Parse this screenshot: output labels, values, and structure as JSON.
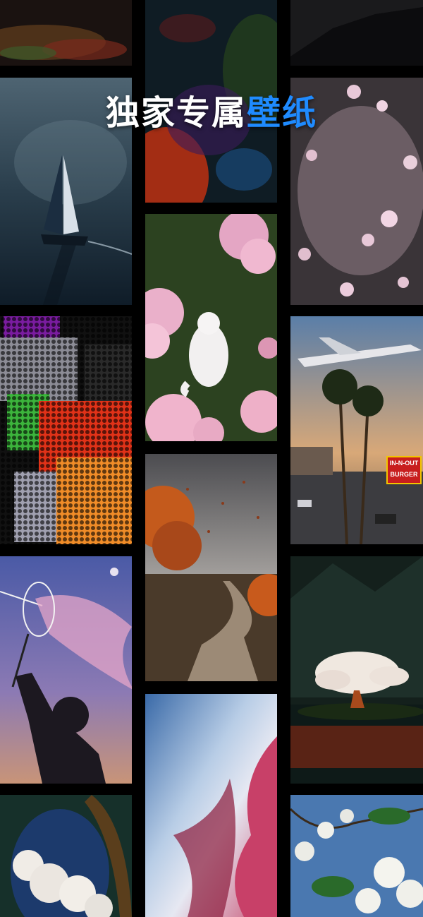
{
  "header": {
    "title_main": "独家专属",
    "title_accent": "壁纸"
  },
  "colors": {
    "accent": "#1f8bff",
    "background": "#000000"
  },
  "wallpapers": [
    {
      "id": "c1-top",
      "subject": "colorful abstract"
    },
    {
      "id": "c1-sailboat",
      "subject": "sailboat on dark sea"
    },
    {
      "id": "c1-pixel",
      "subject": "pixel dot art"
    },
    {
      "id": "c1-dreamy",
      "subject": "person with bubble net"
    },
    {
      "id": "c1-arch",
      "subject": "clouds through arch"
    },
    {
      "id": "c2-abstract",
      "subject": "dark abstract paint"
    },
    {
      "id": "c2-cat",
      "subject": "white cat with pink blossoms"
    },
    {
      "id": "c2-autumn",
      "subject": "autumn road with leaves"
    },
    {
      "id": "c2-paint",
      "subject": "textured paint strokes"
    },
    {
      "id": "c3-mountain",
      "subject": "dark mountain"
    },
    {
      "id": "c3-blossom",
      "subject": "pink blossoms in mist"
    },
    {
      "id": "c3-plane",
      "subject": "airplane over street"
    },
    {
      "id": "c3-tree",
      "subject": "glowing tree by lake"
    },
    {
      "id": "c3-flowers",
      "subject": "white flowers with sky"
    }
  ],
  "sign_text": "IN-N-OUT BURGER"
}
